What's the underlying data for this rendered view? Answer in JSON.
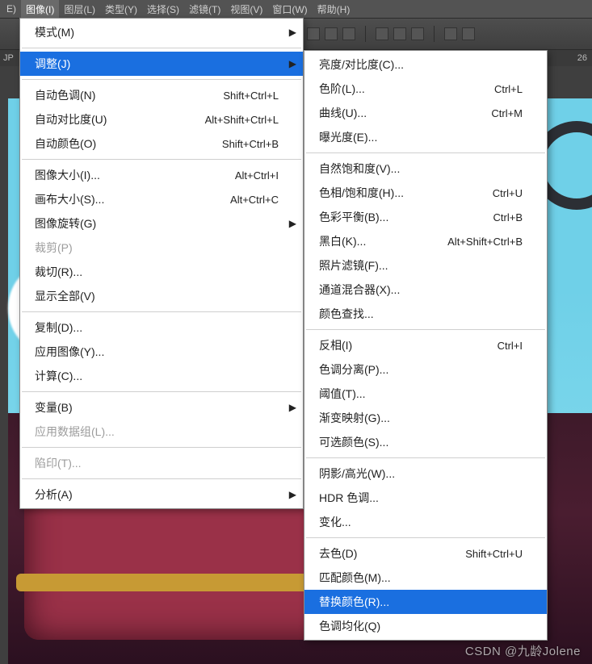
{
  "menubar": {
    "items": [
      {
        "label": "E)"
      },
      {
        "label": "图像(I)",
        "active": true
      },
      {
        "label": "图层(L)"
      },
      {
        "label": "类型(Y)"
      },
      {
        "label": "选择(S)"
      },
      {
        "label": "滤镜(T)"
      },
      {
        "label": "视图(V)"
      },
      {
        "label": "窗口(W)"
      },
      {
        "label": "帮助(H)"
      }
    ]
  },
  "strip2": {
    "right": "26"
  },
  "dropdown_image": [
    {
      "type": "item",
      "label": "模式(M)",
      "submenu": true
    },
    {
      "type": "sep"
    },
    {
      "type": "item",
      "label": "调整(J)",
      "submenu": true,
      "highlight": true
    },
    {
      "type": "sep"
    },
    {
      "type": "item",
      "label": "自动色调(N)",
      "shortcut": "Shift+Ctrl+L"
    },
    {
      "type": "item",
      "label": "自动对比度(U)",
      "shortcut": "Alt+Shift+Ctrl+L"
    },
    {
      "type": "item",
      "label": "自动颜色(O)",
      "shortcut": "Shift+Ctrl+B"
    },
    {
      "type": "sep"
    },
    {
      "type": "item",
      "label": "图像大小(I)...",
      "shortcut": "Alt+Ctrl+I"
    },
    {
      "type": "item",
      "label": "画布大小(S)...",
      "shortcut": "Alt+Ctrl+C"
    },
    {
      "type": "item",
      "label": "图像旋转(G)",
      "submenu": true
    },
    {
      "type": "item",
      "label": "裁剪(P)",
      "disabled": true
    },
    {
      "type": "item",
      "label": "裁切(R)..."
    },
    {
      "type": "item",
      "label": "显示全部(V)"
    },
    {
      "type": "sep"
    },
    {
      "type": "item",
      "label": "复制(D)..."
    },
    {
      "type": "item",
      "label": "应用图像(Y)..."
    },
    {
      "type": "item",
      "label": "计算(C)..."
    },
    {
      "type": "sep"
    },
    {
      "type": "item",
      "label": "变量(B)",
      "submenu": true
    },
    {
      "type": "item",
      "label": "应用数据组(L)...",
      "disabled": true
    },
    {
      "type": "sep"
    },
    {
      "type": "item",
      "label": "陷印(T)...",
      "disabled": true
    },
    {
      "type": "sep"
    },
    {
      "type": "item",
      "label": "分析(A)",
      "submenu": true
    }
  ],
  "dropdown_adjust": [
    {
      "type": "item",
      "label": "亮度/对比度(C)..."
    },
    {
      "type": "item",
      "label": "色阶(L)...",
      "shortcut": "Ctrl+L"
    },
    {
      "type": "item",
      "label": "曲线(U)...",
      "shortcut": "Ctrl+M"
    },
    {
      "type": "item",
      "label": "曝光度(E)..."
    },
    {
      "type": "sep"
    },
    {
      "type": "item",
      "label": "自然饱和度(V)..."
    },
    {
      "type": "item",
      "label": "色相/饱和度(H)...",
      "shortcut": "Ctrl+U"
    },
    {
      "type": "item",
      "label": "色彩平衡(B)...",
      "shortcut": "Ctrl+B"
    },
    {
      "type": "item",
      "label": "黑白(K)...",
      "shortcut": "Alt+Shift+Ctrl+B"
    },
    {
      "type": "item",
      "label": "照片滤镜(F)..."
    },
    {
      "type": "item",
      "label": "通道混合器(X)..."
    },
    {
      "type": "item",
      "label": "颜色查找..."
    },
    {
      "type": "sep"
    },
    {
      "type": "item",
      "label": "反相(I)",
      "shortcut": "Ctrl+I"
    },
    {
      "type": "item",
      "label": "色调分离(P)..."
    },
    {
      "type": "item",
      "label": "阈值(T)..."
    },
    {
      "type": "item",
      "label": "渐变映射(G)..."
    },
    {
      "type": "item",
      "label": "可选颜色(S)..."
    },
    {
      "type": "sep"
    },
    {
      "type": "item",
      "label": "阴影/高光(W)..."
    },
    {
      "type": "item",
      "label": "HDR 色调..."
    },
    {
      "type": "item",
      "label": "变化..."
    },
    {
      "type": "sep"
    },
    {
      "type": "item",
      "label": "去色(D)",
      "shortcut": "Shift+Ctrl+U"
    },
    {
      "type": "item",
      "label": "匹配颜色(M)..."
    },
    {
      "type": "item",
      "label": "替换颜色(R)...",
      "highlight": true
    },
    {
      "type": "item",
      "label": "色调均化(Q)"
    }
  ],
  "watermark": "CSDN @九龄Jolene",
  "strip2_left": "JP"
}
